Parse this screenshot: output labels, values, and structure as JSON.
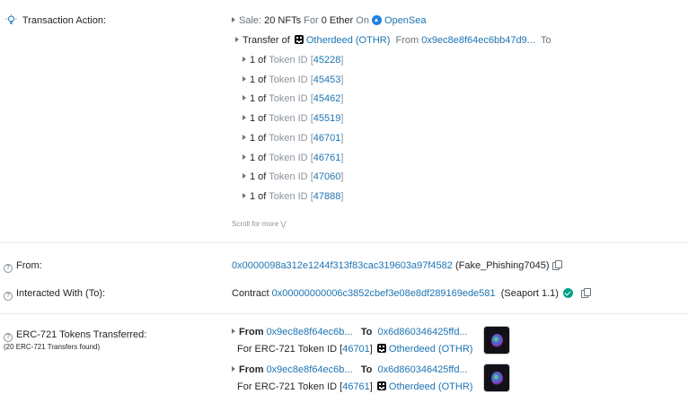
{
  "transaction_action": {
    "label": "Transaction Action:",
    "sale": {
      "prefix": "Sale:",
      "nfts": "20 NFTs",
      "for_word": "For",
      "amount": "0 Ether",
      "on_word": "On",
      "marketplace": "OpenSea"
    },
    "transfer": {
      "prefix": "Transfer of",
      "collection": "Otherdeed (OTHR)",
      "from_word": "From",
      "from_address": "0x9ec8e8f64ec6bb47d9...",
      "to_word": "To"
    },
    "tokens": [
      {
        "qty": "1 of",
        "label": "Token ID",
        "id": "45228"
      },
      {
        "qty": "1 of",
        "label": "Token ID",
        "id": "45453"
      },
      {
        "qty": "1 of",
        "label": "Token ID",
        "id": "45462"
      },
      {
        "qty": "1 of",
        "label": "Token ID",
        "id": "45519"
      },
      {
        "qty": "1 of",
        "label": "Token ID",
        "id": "46701"
      },
      {
        "qty": "1 of",
        "label": "Token ID",
        "id": "46761"
      },
      {
        "qty": "1 of",
        "label": "Token ID",
        "id": "47060"
      },
      {
        "qty": "1 of",
        "label": "Token ID",
        "id": "47888"
      }
    ],
    "scroll_more": "Scroll for more"
  },
  "from": {
    "label": "From:",
    "address": "0x0000098a312e1244f313f83cac319603a97f4582",
    "name_tag": "(Fake_Phishing7045)"
  },
  "interacted_with": {
    "label": "Interacted With (To):",
    "prefix": "Contract",
    "address": "0x00000000006c3852cbef3e08e8df289169ede581",
    "name_tag": "(Seaport 1.1)"
  },
  "erc721": {
    "label": "ERC-721 Tokens Transferred:",
    "sub_label": "(20 ERC-721 Transfers found)",
    "transfers": [
      {
        "from_word": "From",
        "from_address": "0x9ec8e8f64ec6b...",
        "to_word": "To",
        "to_address": "0x6d860346425ffd...",
        "for_text": "For ERC-721 Token ID",
        "token_id": "46701",
        "collection": "Otherdeed (OTHR)"
      },
      {
        "from_word": "From",
        "from_address": "0x9ec8e8f64ec6b...",
        "to_word": "To",
        "to_address": "0x6d860346425ffd...",
        "for_text": "For ERC-721 Token ID",
        "token_id": "46761",
        "collection": "Otherdeed (OTHR)"
      }
    ]
  },
  "colors": {
    "link": "#1d74b3",
    "verified": "#00a186",
    "opensea": "#2081e2"
  }
}
